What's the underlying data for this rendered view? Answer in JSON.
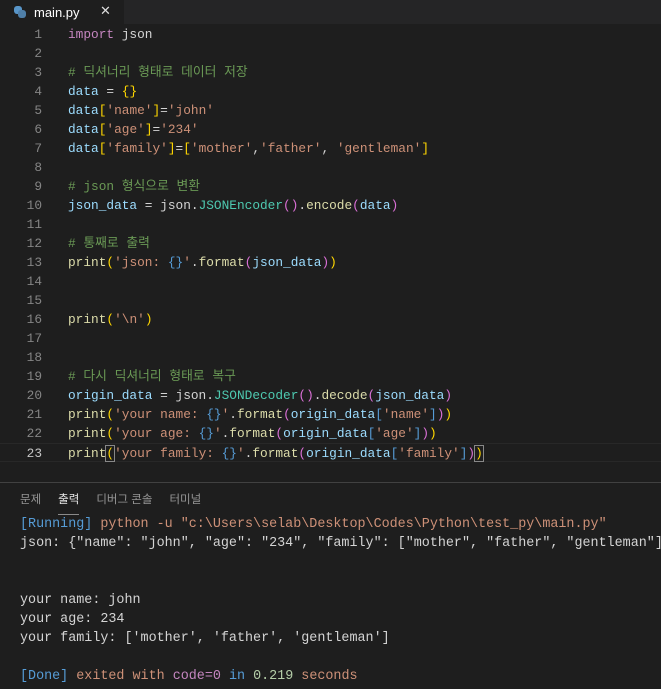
{
  "tab": {
    "filename": "main.py",
    "close": "✕"
  },
  "code_lines": [
    [
      [
        "import",
        "kw"
      ],
      [
        " json",
        "pl"
      ]
    ],
    [],
    [
      [
        "# 딕셔너리 형태로 데이터 저장",
        "cm"
      ]
    ],
    [
      [
        "data",
        "var"
      ],
      [
        " = ",
        "pl"
      ],
      [
        "{}",
        "br"
      ]
    ],
    [
      [
        "data",
        "var"
      ],
      [
        "[",
        "br"
      ],
      [
        "'name'",
        "str"
      ],
      [
        "]",
        "br"
      ],
      [
        "=",
        "pl"
      ],
      [
        "'john'",
        "str"
      ]
    ],
    [
      [
        "data",
        "var"
      ],
      [
        "[",
        "br"
      ],
      [
        "'age'",
        "str"
      ],
      [
        "]",
        "br"
      ],
      [
        "=",
        "pl"
      ],
      [
        "'234'",
        "str"
      ]
    ],
    [
      [
        "data",
        "var"
      ],
      [
        "[",
        "br"
      ],
      [
        "'family'",
        "str"
      ],
      [
        "]",
        "br"
      ],
      [
        "=",
        "pl"
      ],
      [
        "[",
        "br"
      ],
      [
        "'mother'",
        "str"
      ],
      [
        ",",
        "pl"
      ],
      [
        "'father'",
        "str"
      ],
      [
        ", ",
        "pl"
      ],
      [
        "'gentleman'",
        "str"
      ],
      [
        "]",
        "br"
      ]
    ],
    [],
    [
      [
        "# json 형식으로 변환",
        "cm"
      ]
    ],
    [
      [
        "json_data",
        "var"
      ],
      [
        " = json.",
        "pl"
      ],
      [
        "JSONEncoder",
        "cls"
      ],
      [
        "()",
        "br2"
      ],
      [
        ".",
        "pl"
      ],
      [
        "encode",
        "fn"
      ],
      [
        "(",
        "br2"
      ],
      [
        "data",
        "var"
      ],
      [
        ")",
        "br2"
      ]
    ],
    [],
    [
      [
        "# 통째로 출력",
        "cm"
      ]
    ],
    [
      [
        "print",
        "fn"
      ],
      [
        "(",
        "br"
      ],
      [
        "'json: ",
        "str"
      ],
      [
        "{}",
        "fmt"
      ],
      [
        "'",
        "str"
      ],
      [
        ".",
        "pl"
      ],
      [
        "format",
        "fn"
      ],
      [
        "(",
        "br2"
      ],
      [
        "json_data",
        "var"
      ],
      [
        ")",
        "br2"
      ],
      [
        ")",
        "br"
      ]
    ],
    [],
    [],
    [
      [
        "print",
        "fn"
      ],
      [
        "(",
        "br"
      ],
      [
        "'\\n'",
        "str"
      ],
      [
        ")",
        "br"
      ]
    ],
    [],
    [],
    [
      [
        "# 다시 딕셔너리 형태로 복구",
        "cm"
      ]
    ],
    [
      [
        "origin_data",
        "var"
      ],
      [
        " = json.",
        "pl"
      ],
      [
        "JSONDecoder",
        "cls"
      ],
      [
        "()",
        "br2"
      ],
      [
        ".",
        "pl"
      ],
      [
        "decode",
        "fn"
      ],
      [
        "(",
        "br2"
      ],
      [
        "json_data",
        "var"
      ],
      [
        ")",
        "br2"
      ]
    ],
    [
      [
        "print",
        "fn"
      ],
      [
        "(",
        "br"
      ],
      [
        "'your name: ",
        "str"
      ],
      [
        "{}",
        "fmt"
      ],
      [
        "'",
        "str"
      ],
      [
        ".",
        "pl"
      ],
      [
        "format",
        "fn"
      ],
      [
        "(",
        "br2"
      ],
      [
        "origin_data",
        "var"
      ],
      [
        "[",
        "fmt"
      ],
      [
        "'name'",
        "str"
      ],
      [
        "]",
        "fmt"
      ],
      [
        ")",
        "br2"
      ],
      [
        ")",
        "br"
      ]
    ],
    [
      [
        "print",
        "fn"
      ],
      [
        "(",
        "br"
      ],
      [
        "'your age: ",
        "str"
      ],
      [
        "{}",
        "fmt"
      ],
      [
        "'",
        "str"
      ],
      [
        ".",
        "pl"
      ],
      [
        "format",
        "fn"
      ],
      [
        "(",
        "br2"
      ],
      [
        "origin_data",
        "var"
      ],
      [
        "[",
        "fmt"
      ],
      [
        "'age'",
        "str"
      ],
      [
        "]",
        "fmt"
      ],
      [
        ")",
        "br2"
      ],
      [
        ")",
        "br"
      ]
    ],
    [
      [
        "print",
        "fn"
      ],
      [
        "(",
        "br bm"
      ],
      [
        "'your family: ",
        "str"
      ],
      [
        "{}",
        "fmt"
      ],
      [
        "'",
        "str"
      ],
      [
        ".",
        "pl"
      ],
      [
        "format",
        "fn"
      ],
      [
        "(",
        "br2"
      ],
      [
        "origin_data",
        "var"
      ],
      [
        "[",
        "fmt"
      ],
      [
        "'family'",
        "str"
      ],
      [
        "]",
        "fmt"
      ],
      [
        ")",
        "br2"
      ],
      [
        ")",
        "br bm"
      ]
    ]
  ],
  "current_line": 23,
  "panel": {
    "tabs": [
      "문제",
      "출력",
      "디버그 콘솔",
      "터미널"
    ],
    "active_tab": "출력",
    "output": [
      [
        [
          "[Running]",
          "blue"
        ],
        [
          " python -u \"c:\\Users\\selab\\Desktop\\Codes\\Python\\test_py\\main.py\"",
          "orange"
        ]
      ],
      [
        [
          "json: {\"name\": \"john\", \"age\": \"234\", \"family\": [\"mother\", \"father\", \"gentleman\"]}",
          ""
        ]
      ],
      [],
      [],
      [
        [
          "your name: john",
          ""
        ]
      ],
      [
        [
          "your age: 234",
          ""
        ]
      ],
      [
        [
          "your family: ['mother', 'father', 'gentleman']",
          ""
        ]
      ],
      [],
      [
        [
          "[Done]",
          "blue"
        ],
        [
          " exited with ",
          "orange"
        ],
        [
          "code=0",
          "purple"
        ],
        [
          " in ",
          "blue"
        ],
        [
          "0.219",
          "green"
        ],
        [
          " seconds",
          "orange"
        ]
      ]
    ]
  }
}
